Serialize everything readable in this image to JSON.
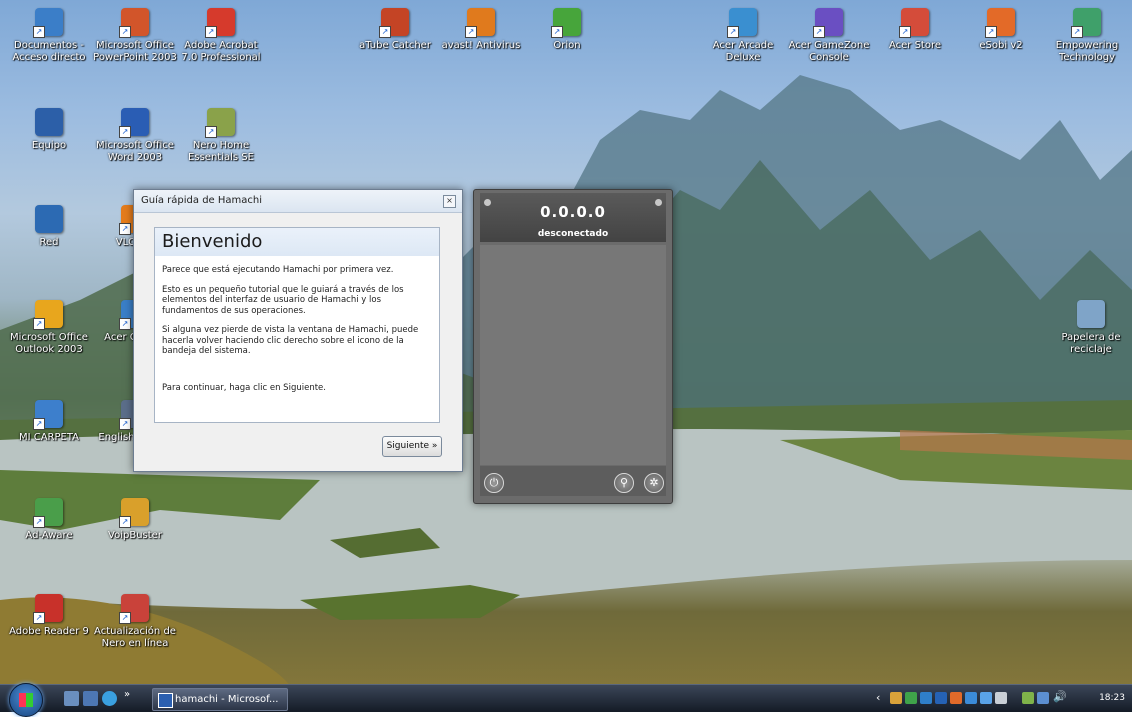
{
  "desktop_icons": [
    {
      "label": "Documentos - Acceso directo",
      "color": "#3b7ec8"
    },
    {
      "label": "Microsoft Office PowerPoint 2003",
      "color": "#d2552a"
    },
    {
      "label": "Adobe Acrobat 7.0 Professional",
      "color": "#d63a2c"
    },
    {
      "label": "aTube Catcher",
      "color": "#c44425"
    },
    {
      "label": "avast! Antivirus",
      "color": "#e07a1d"
    },
    {
      "label": "Orion",
      "color": "#47a53b"
    },
    {
      "label": "Acer Arcade Deluxe",
      "color": "#3a8fd0"
    },
    {
      "label": "Acer GameZone Console",
      "color": "#6a4fc2"
    },
    {
      "label": "Acer Store",
      "color": "#d44c3a"
    },
    {
      "label": "eSobi v2",
      "color": "#e36a28"
    },
    {
      "label": "Empowering Technology",
      "color": "#3fa06a"
    },
    {
      "label": "Equipo",
      "color": "#2c5fa8"
    },
    {
      "label": "Microsoft Office Word 2003",
      "color": "#2a5db4"
    },
    {
      "label": "Nero Home Essentials SE",
      "color": "#8aa24a"
    },
    {
      "label": "Red",
      "color": "#2c6ab3"
    },
    {
      "label": "VLC me",
      "color": "#e57c1c"
    },
    {
      "label": "Microsoft Office Outlook 2003",
      "color": "#e8a61d"
    },
    {
      "label": "Acer Cr Web",
      "color": "#3a7fc8"
    },
    {
      "label": "Papelera de reciclaje",
      "color": "#7fa4c8"
    },
    {
      "label": "MI CARPETA",
      "color": "#3d7fcc"
    },
    {
      "label": "English Interpr",
      "color": "#5b6e8a"
    },
    {
      "label": "Ad-Aware",
      "color": "#4a9e4a"
    },
    {
      "label": "VoipBuster",
      "color": "#d9a02b"
    },
    {
      "label": "Adobe Reader 9",
      "color": "#c8312a"
    },
    {
      "label": "Actualización de Nero en línea",
      "color": "#c9423a"
    }
  ],
  "dialog": {
    "title": "Guía rápida de Hamachi",
    "heading": "Bienvenido",
    "p1": "Parece que está ejecutando Hamachi por primera vez.",
    "p2": "Esto es un pequeño tutorial que le guiará a través de los elementos del interfaz de usuario de Hamachi y los fundamentos de sus operaciones.",
    "p3": "Si alguna vez pierde de vista la ventana de Hamachi, puede hacerla volver haciendo clic derecho sobre el icono de la bandeja del sistema.",
    "p4": "Para continuar, haga clic en Siguiente.",
    "next_label": "Siguiente »"
  },
  "client": {
    "ip": "0.0.0.0",
    "status": "desconectado"
  },
  "taskbar": {
    "task_label": "hamachi - Microsof...",
    "clock": "18:23"
  }
}
